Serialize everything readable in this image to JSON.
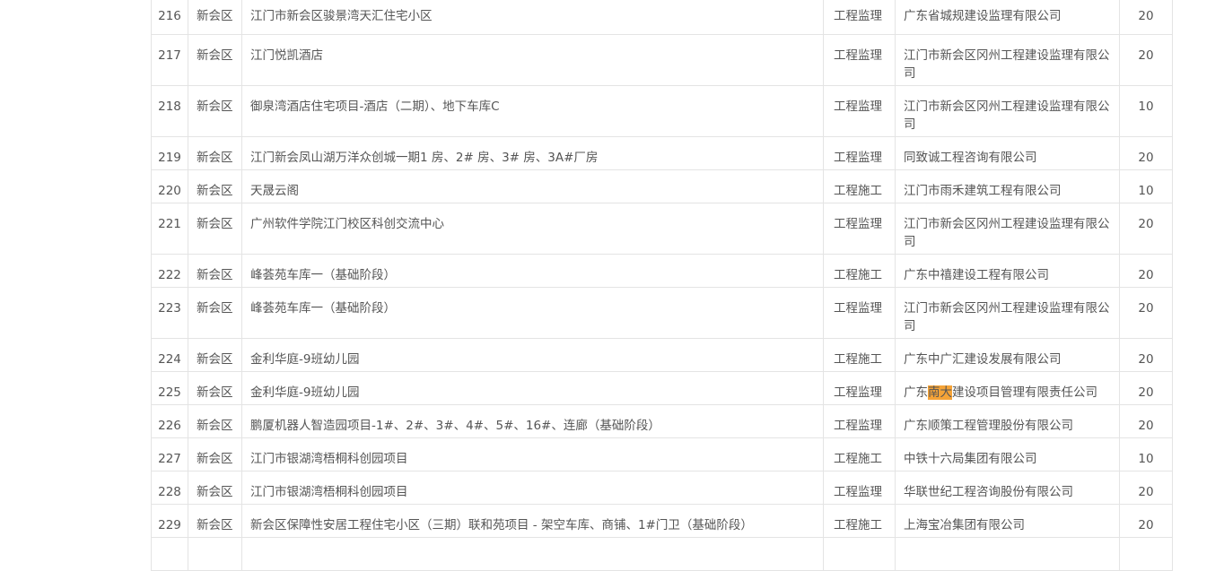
{
  "table": {
    "highlight_color": "#f5a337",
    "rows": [
      {
        "no": "216",
        "district": "新会区",
        "project": "江门市新会区骏景湾天汇住宅小区",
        "type": "工程监理",
        "company": "广东省城规建设监理有限公司",
        "score": "20"
      },
      {
        "no": "217",
        "district": "新会区",
        "project": "江门悦凯酒店",
        "type": "工程监理",
        "company": "江门市新会区冈州工程建设监理有限公司",
        "score": "20"
      },
      {
        "no": "218",
        "district": "新会区",
        "project": "御泉湾酒店住宅项目-酒店（二期）、地下车库C",
        "type": "工程监理",
        "company": "江门市新会区冈州工程建设监理有限公司",
        "score": "10"
      },
      {
        "no": "219",
        "district": "新会区",
        "project": "江门新会凤山湖万洋众创城一期1 房、2# 房、3# 房、3A#厂房",
        "type": "工程监理",
        "company": "同致诚工程咨询有限公司",
        "score": "20"
      },
      {
        "no": "220",
        "district": "新会区",
        "project": "天晟云阁",
        "type": "工程施工",
        "company": "江门市雨禾建筑工程有限公司",
        "score": "10"
      },
      {
        "no": "221",
        "district": "新会区",
        "project": "广州软件学院江门校区科创交流中心",
        "type": "工程监理",
        "company": "江门市新会区冈州工程建设监理有限公司",
        "score": "20"
      },
      {
        "no": "222",
        "district": "新会区",
        "project": "峰荟苑车库一（基础阶段）",
        "type": "工程施工",
        "company": "广东中禧建设工程有限公司",
        "score": "20"
      },
      {
        "no": "223",
        "district": "新会区",
        "project": "峰荟苑车库一（基础阶段）",
        "type": "工程监理",
        "company": "江门市新会区冈州工程建设监理有限公司",
        "score": "20"
      },
      {
        "no": "224",
        "district": "新会区",
        "project": "金利华庭-9班幼儿园",
        "type": "工程施工",
        "company": "广东中广汇建设发展有限公司",
        "score": "20"
      },
      {
        "no": "225",
        "district": "新会区",
        "project": "金利华庭-9班幼儿园",
        "type": "工程监理",
        "company_pre": "广东",
        "company_highlight": "南大",
        "company_post": "建设项目管理有限责任公司",
        "score": "20"
      },
      {
        "no": "226",
        "district": "新会区",
        "project": "鹏厦机器人智造园项目-1#、2#、3#、4#、5#、16#、连廊（基础阶段）",
        "type": "工程监理",
        "company": "广东顺策工程管理股份有限公司",
        "score": "20"
      },
      {
        "no": "227",
        "district": "新会区",
        "project": "江门市银湖湾梧桐科创园项目",
        "type": "工程施工",
        "company": "中铁十六局集团有限公司",
        "score": "10"
      },
      {
        "no": "228",
        "district": "新会区",
        "project": "江门市银湖湾梧桐科创园项目",
        "type": "工程监理",
        "company": "华联世纪工程咨询股份有限公司",
        "score": "20"
      },
      {
        "no": "229",
        "district": "新会区",
        "project": "新会区保障性安居工程住宅小区（三期）联和苑项目 - 架空车库、商铺、1#门卫（基础阶段）",
        "type": "工程施工",
        "company": "上海宝冶集团有限公司",
        "score": "20"
      }
    ]
  }
}
